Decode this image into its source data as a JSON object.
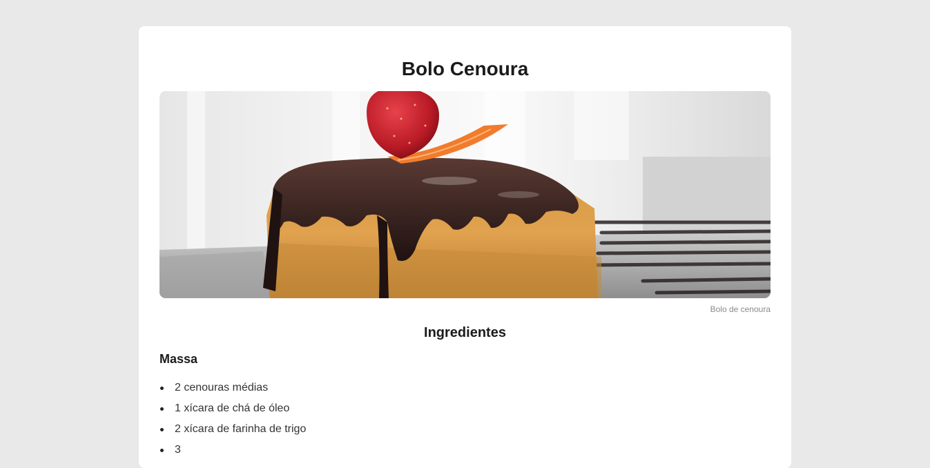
{
  "recipe": {
    "title": "Bolo Cenoura",
    "image_caption": "Bolo de cenoura",
    "ingredients_heading": "Ingredientes",
    "groups": [
      {
        "name": "Massa",
        "items": [
          "2 cenouras médias",
          "1 xícara de chá de óleo",
          "2 xícara de farinha de trigo",
          "3"
        ]
      }
    ]
  },
  "colors": {
    "page_background": "#e9e9e9",
    "card_background": "#ffffff",
    "text": "#1b1b1b",
    "caption": "#8a8a8a"
  }
}
